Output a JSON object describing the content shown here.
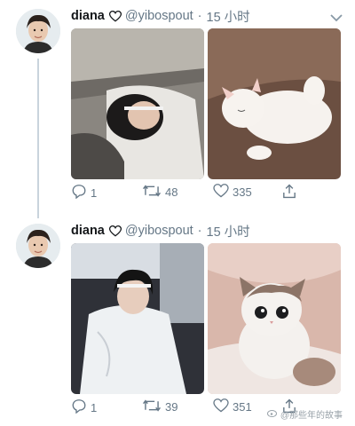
{
  "tweets": [
    {
      "name": "diana",
      "handle": "@yibospout",
      "separator": "·",
      "time": "15 小时",
      "stats": {
        "replies": "1",
        "retweets": "48",
        "likes": "335"
      }
    },
    {
      "name": "diana",
      "handle": "@yibospout",
      "separator": "·",
      "time": "15 小时",
      "stats": {
        "replies": "1",
        "retweets": "39",
        "likes": "351"
      }
    }
  ],
  "watermark": "@那些年的故事",
  "icons": {
    "reply": "reply-icon",
    "retweet": "retweet-icon",
    "like": "heart-icon",
    "share": "share-icon",
    "caret": "chevron-down-icon"
  },
  "colors": {
    "muted": "#657786",
    "thread": "#c9d4dc"
  }
}
